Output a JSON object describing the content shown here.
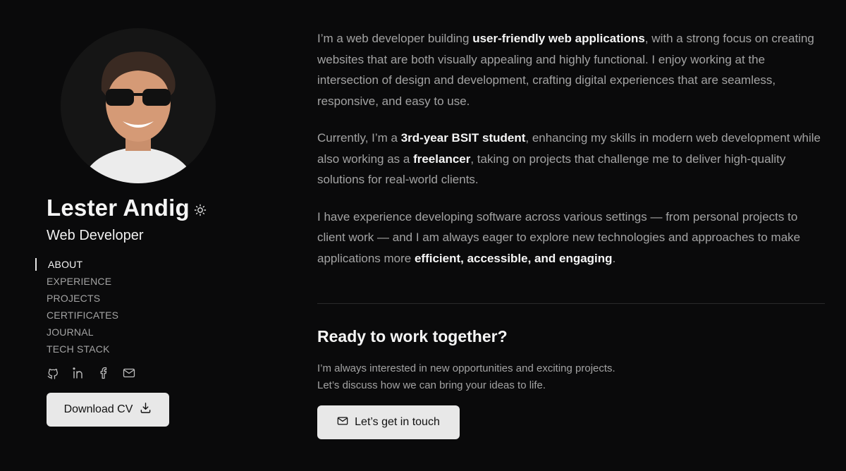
{
  "profile": {
    "name": "Lester Andig",
    "role": "Web Developer",
    "avatar_icon": "profile-photo"
  },
  "nav": {
    "items": [
      "ABOUT",
      "EXPERIENCE",
      "PROJECTS",
      "CERTIFICATES",
      "JOURNAL",
      "TECH STACK"
    ],
    "active": "ABOUT"
  },
  "socials": [
    "github-icon",
    "linkedin-icon",
    "facebook-icon",
    "mail-icon"
  ],
  "download_cv": {
    "label": "Download CV",
    "icon": "download-icon"
  },
  "about": {
    "p1": [
      {
        "t": "I’m a web developer building "
      },
      {
        "t": "user-friendly web applications",
        "b": true
      },
      {
        "t": ", with a strong focus on creating websites that are both visually appealing and highly functional. I enjoy working at the intersection of design and development, crafting digital experiences that are seamless, responsive, and easy to use."
      }
    ],
    "p2": [
      {
        "t": "Currently, I’m a "
      },
      {
        "t": "3rd-year BSIT student",
        "b": true
      },
      {
        "t": ", enhancing my skills in modern web development while also working as a "
      },
      {
        "t": "freelancer",
        "b": true
      },
      {
        "t": ", taking on projects that challenge me to deliver high-quality solutions for real-world clients."
      }
    ],
    "p3": [
      {
        "t": "I have experience developing software across various settings — from personal projects to client work — and I am always eager to explore new technologies and approaches to make applications more "
      },
      {
        "t": "efficient, accessible, and engaging",
        "b": true
      },
      {
        "t": "."
      }
    ]
  },
  "cta": {
    "title": "Ready to work together?",
    "text": "I’m always interested in new opportunities and exciting projects. Let’s discuss how we can bring your ideas to life.",
    "button_label": "Let’s get in touch",
    "button_icon": "mail-icon"
  },
  "colors": {
    "background": "#0a0a0b",
    "text": "#a3a3a3",
    "heading": "#f5f5f5",
    "button": "#e8e8e8"
  }
}
